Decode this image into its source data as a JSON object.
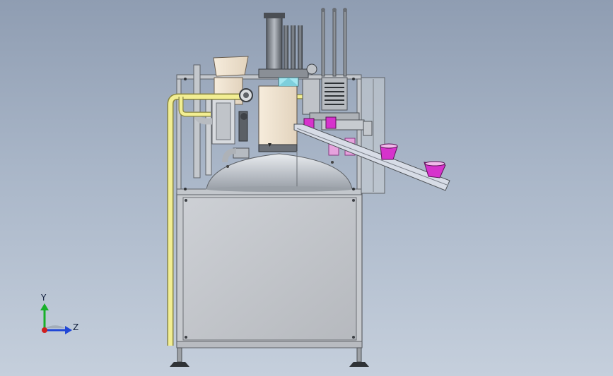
{
  "viewport": {
    "background_top": "#8f9db2",
    "background_bottom": "#c5cfdc"
  },
  "model": {
    "frame_color": "#c8ccd2",
    "panel_color": "#c4c7cc",
    "tank_color": "#c9ced4",
    "pipe_color": "#f2ee93",
    "cup_color": "#d633cc",
    "chute_color": "#d7dce6"
  },
  "triad": {
    "y_label": "Y",
    "z_label": "Z",
    "y_color": "#18b02a",
    "z_color": "#2147d6",
    "x_color": "#d01f1f"
  }
}
